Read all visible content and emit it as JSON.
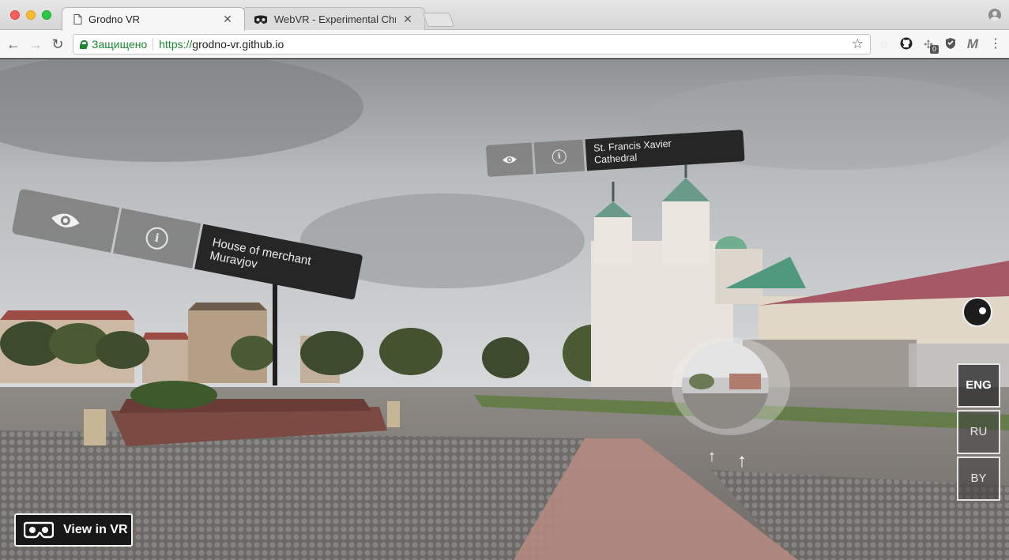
{
  "browser": {
    "tabs": [
      {
        "title": "Grodno VR",
        "active": true
      },
      {
        "title": "WebVR - Experimental Chromi",
        "active": false
      }
    ],
    "security_label": "Защищено",
    "url_scheme": "https://",
    "url_host": "grodno-vr.github.io",
    "extension_badge": "0",
    "extension_letter": "M"
  },
  "scene": {
    "hotspots": {
      "cathedral": {
        "line1": "St. Francis Xavier",
        "line2": "Cathedral"
      },
      "merchant": {
        "line1": "House of merchant",
        "line2": "Muravjov"
      }
    },
    "languages": [
      {
        "label": "ENG",
        "active": true
      },
      {
        "label": "RU",
        "active": false
      },
      {
        "label": "BY",
        "active": false
      }
    ],
    "vr_button_label": "View in VR"
  },
  "colors": {
    "secure_green": "#1a8a2f",
    "label_dark": "#262626",
    "button_gray": "#808080"
  }
}
